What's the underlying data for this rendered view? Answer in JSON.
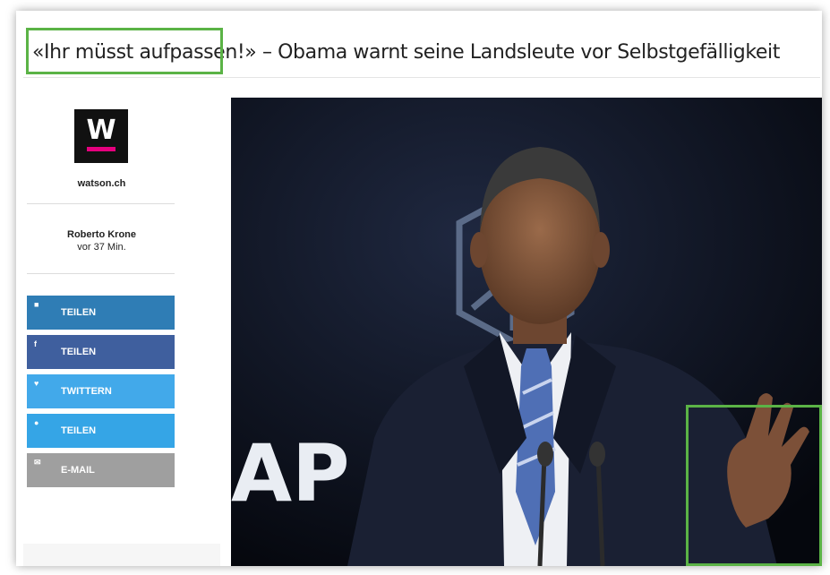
{
  "article": {
    "headline": "«Ihr müsst aufpassen!» – Obama warnt seine Landsleute vor Selbstgefälligkeit"
  },
  "sidebar": {
    "logo_letter": "W",
    "source": "watson.ch",
    "author": "Roberto Krone",
    "time": "vor 37 Min.",
    "share_buttons": [
      {
        "label": "TEILEN",
        "icon": "linkedin-icon",
        "color": "#2f7db5"
      },
      {
        "label": "TEILEN",
        "icon": "facebook-icon",
        "color": "#3f5f9e"
      },
      {
        "label": "TWITTERN",
        "icon": "twitter-icon",
        "color": "#42a9ea"
      },
      {
        "label": "TEILEN",
        "icon": "skype-icon",
        "color": "#35a5e6"
      },
      {
        "label": "E-MAIL",
        "icon": "mail-icon",
        "color": "#9f9f9f"
      }
    ]
  },
  "photo": {
    "backdrop_letters": [
      "A",
      "P"
    ],
    "highlight_color": "#5bb346"
  }
}
